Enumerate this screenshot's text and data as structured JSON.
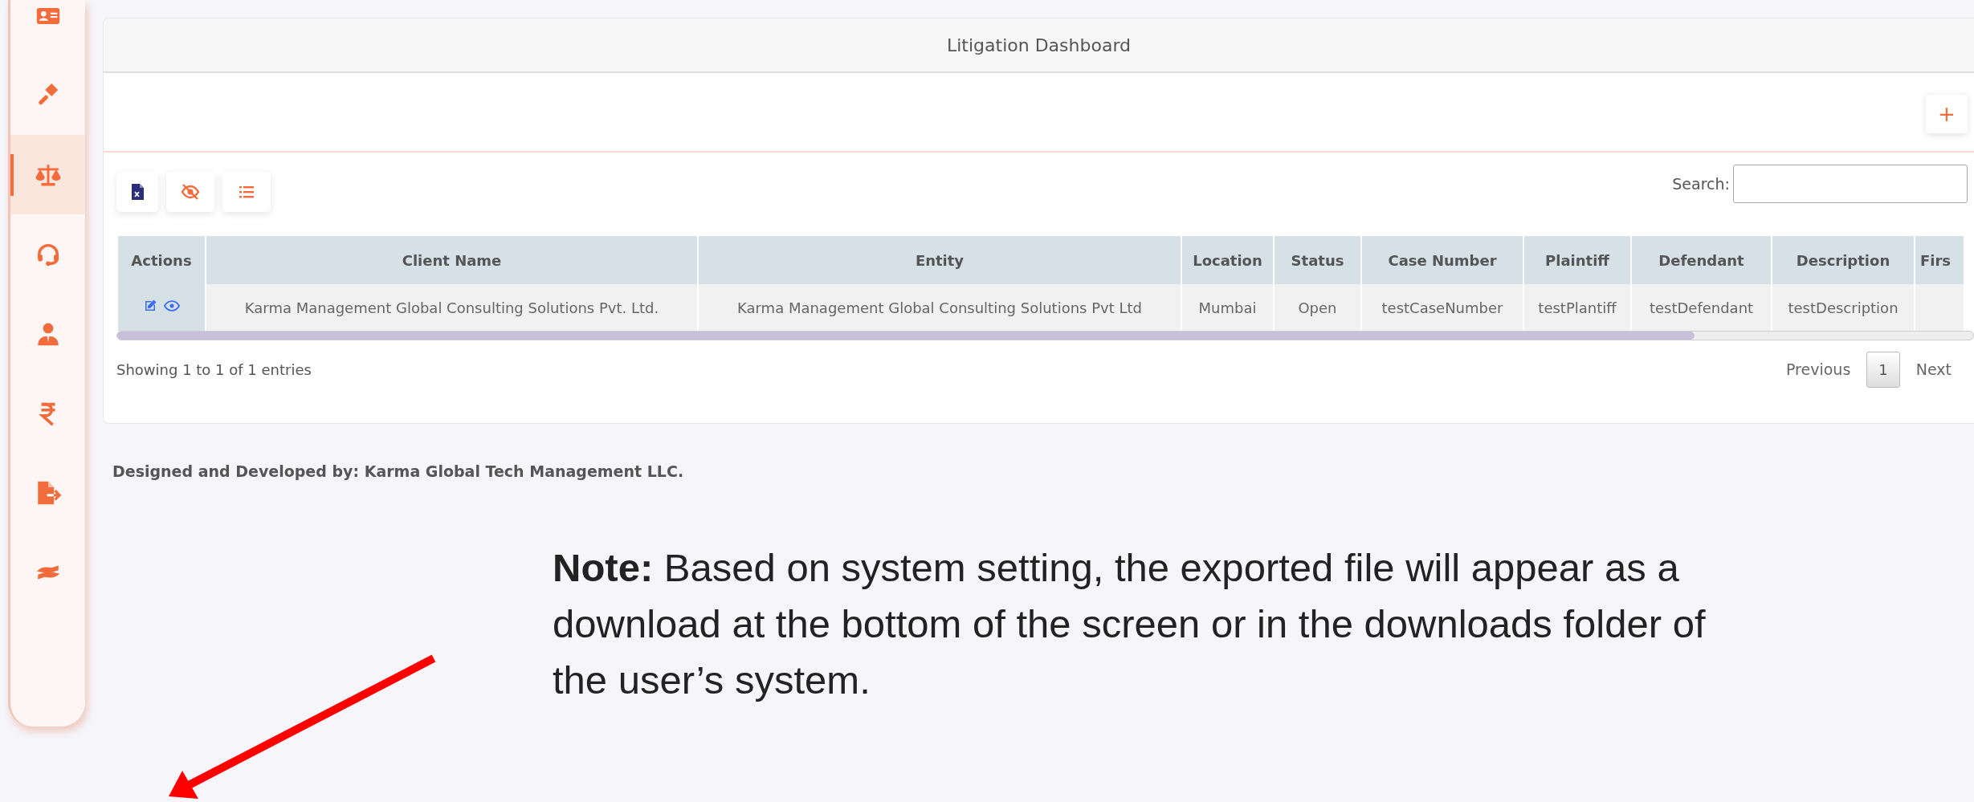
{
  "sidebar": {
    "items": [
      {
        "selected": false
      },
      {
        "selected": false
      },
      {
        "selected": true
      },
      {
        "selected": false
      },
      {
        "selected": false
      },
      {
        "selected": false
      },
      {
        "selected": false
      },
      {
        "selected": false
      }
    ]
  },
  "card": {
    "title": "Litigation Dashboard",
    "add_button": "+",
    "search": {
      "label": "Search:"
    }
  },
  "table": {
    "columns": [
      "Actions",
      "Client Name",
      "Entity",
      "Location",
      "Status",
      "Case Number",
      "Plaintiff",
      "Defendant",
      "Description",
      "Firs"
    ],
    "rows": [
      {
        "cells": [
          "",
          "Karma Management Global Consulting Solutions Pvt. Ltd.",
          "Karma Management Global Consulting Solutions Pvt Ltd",
          "Mumbai",
          "Open",
          "testCaseNumber",
          "testPlantiff",
          "testDefendant",
          "testDescription"
        ]
      }
    ]
  },
  "info": "Showing 1 to 1 of 1 entries",
  "pagination": {
    "previous": "Previous",
    "pages": [
      {
        "label": "1",
        "selected": true
      }
    ],
    "next": "Next"
  },
  "footer": "Designed and Developed by: Karma Global Tech Management LLC.",
  "note": "**Note:** Based on system setting, the exported file will appear as a download at the bottom of the screen or in the downloads folder of the user’s system."
}
